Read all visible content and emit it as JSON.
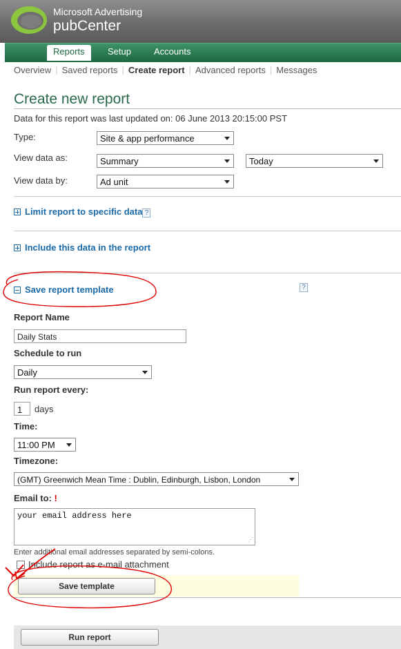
{
  "header": {
    "brand_small": "Microsoft Advertising",
    "brand_big": "pubCenter"
  },
  "main_nav": {
    "tabs": [
      {
        "label": "Reports",
        "active": true
      },
      {
        "label": "Setup",
        "active": false
      },
      {
        "label": "Accounts",
        "active": false
      }
    ]
  },
  "sub_nav": {
    "items": [
      {
        "label": "Overview",
        "current": false
      },
      {
        "label": "Saved reports",
        "current": false
      },
      {
        "label": "Create report",
        "current": true
      },
      {
        "label": "Advanced reports",
        "current": false
      },
      {
        "label": "Messages",
        "current": false
      }
    ]
  },
  "page": {
    "title": "Create new report",
    "updated_text": "Data for this report was last updated on: 06 June 2013 20:15:00 PST"
  },
  "form": {
    "type_label": "Type:",
    "type_value": "Site & app performance",
    "view_as_label": "View data as:",
    "view_as_value": "Summary",
    "period_value": "Today",
    "view_by_label": "View data by:",
    "view_by_value": "Ad unit"
  },
  "sections": {
    "limit": "Limit report to specific data",
    "include": "Include this data in the report",
    "save_template": "Save report template",
    "help_glyph": "?"
  },
  "template": {
    "report_name_label": "Report Name",
    "report_name_value": "Daily Stats",
    "schedule_label": "Schedule to run",
    "schedule_value": "Daily",
    "run_every_label": "Run report every:",
    "run_every_value": "1",
    "run_every_unit": "days",
    "time_label": "Time:",
    "time_value": "11:00 PM",
    "timezone_label": "Timezone:",
    "timezone_value": "(GMT) Greenwich Mean Time : Dublin, Edinburgh, Lisbon, London",
    "email_label": "Email to:",
    "email_required": "!",
    "email_value": "your email address here",
    "email_hint": "Enter additional email addresses separated by semi-colons.",
    "attachment_label": "Include report as e-mail attachment",
    "attachment_checked": false,
    "save_button": "Save template"
  },
  "footer": {
    "run_button": "Run report"
  },
  "colors": {
    "nav_green": "#1f6b43",
    "title_green": "#2a6a4b",
    "link_blue": "#1a6aa8",
    "annotation_red": "#e00000"
  }
}
